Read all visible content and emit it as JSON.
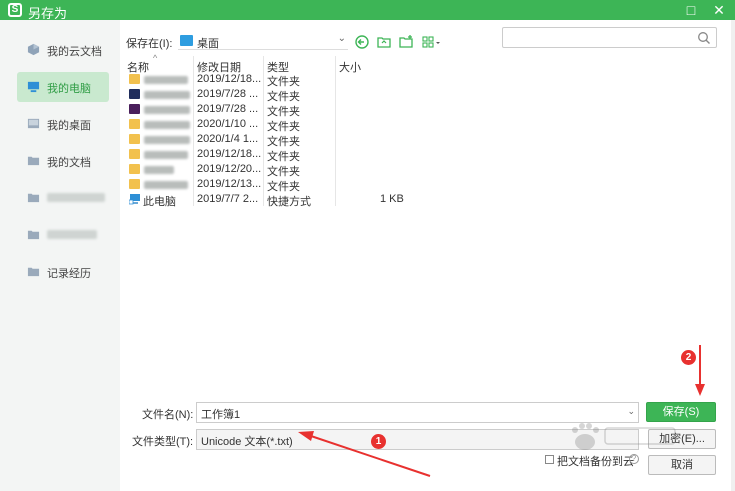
{
  "window": {
    "title": "另存为",
    "logo_glyph": "S",
    "maximize_glyph": "□",
    "close_glyph": "✕"
  },
  "sidebar": {
    "items": [
      {
        "label": "我的云文档",
        "icon": "cloud-docs-icon"
      },
      {
        "label": "我的电脑",
        "icon": "computer-icon",
        "active": true
      },
      {
        "label": "我的桌面",
        "icon": "desktop-icon"
      },
      {
        "label": "我的文档",
        "icon": "folder-icon"
      },
      {
        "label": "",
        "icon": "folder-icon",
        "blurred": true
      },
      {
        "label": "",
        "icon": "folder-icon",
        "blurred": true
      },
      {
        "label": "记录经历",
        "icon": "folder-icon"
      }
    ]
  },
  "location": {
    "label": "保存在(I):",
    "value": "桌面"
  },
  "toolbar": {
    "icons": [
      "back-icon",
      "refresh-folder-icon",
      "new-folder-icon",
      "view-mode-icon"
    ]
  },
  "search": {
    "placeholder": ""
  },
  "columns": {
    "name": "名称",
    "date": "修改日期",
    "type": "类型",
    "size": "大小"
  },
  "files": [
    {
      "name": "",
      "date": "2019/12/18...",
      "type": "文件夹",
      "size": "",
      "icon": "folder-icon",
      "blurred": true
    },
    {
      "name": "",
      "date": "2019/7/28 ...",
      "type": "文件夹",
      "size": "",
      "icon": "app-folder-icon",
      "blurred": true
    },
    {
      "name": "",
      "date": "2019/7/28 ...",
      "type": "文件夹",
      "size": "",
      "icon": "app-folder-icon",
      "blurred": true
    },
    {
      "name": "",
      "date": "2020/1/10 ...",
      "type": "文件夹",
      "size": "",
      "icon": "folder-icon",
      "blurred": true
    },
    {
      "name": "",
      "date": "2020/1/4 1...",
      "type": "文件夹",
      "size": "",
      "icon": "folder-icon",
      "blurred": true
    },
    {
      "name": "",
      "date": "2019/12/18...",
      "type": "文件夹",
      "size": "",
      "icon": "folder-icon",
      "blurred": true
    },
    {
      "name": "",
      "date": "2019/12/20...",
      "type": "文件夹",
      "size": "",
      "icon": "folder-icon",
      "blurred": true
    },
    {
      "name": "",
      "date": "2019/12/13...",
      "type": "文件夹",
      "size": "",
      "icon": "folder-icon",
      "blurred": true
    },
    {
      "name": "此电脑",
      "date": "2019/7/7 2...",
      "type": "快捷方式",
      "size": "1 KB",
      "icon": "computer-shortcut-icon",
      "blurred": false
    }
  ],
  "form": {
    "filename_label": "文件名(N):",
    "filename_value": "工作簿1",
    "filetype_label": "文件类型(T):",
    "filetype_value": "Unicode 文本(*.txt)",
    "save_label": "保存(S)",
    "encrypt_label": "加密(E)...",
    "cancel_label": "取消",
    "backup_label": "把文档备份到云"
  },
  "annotations": {
    "badge_1": "1",
    "badge_2": "2"
  },
  "colors": {
    "accent": "#3db556",
    "annotation": "#e8312f",
    "sidebar_active": "#c9e9cf"
  }
}
